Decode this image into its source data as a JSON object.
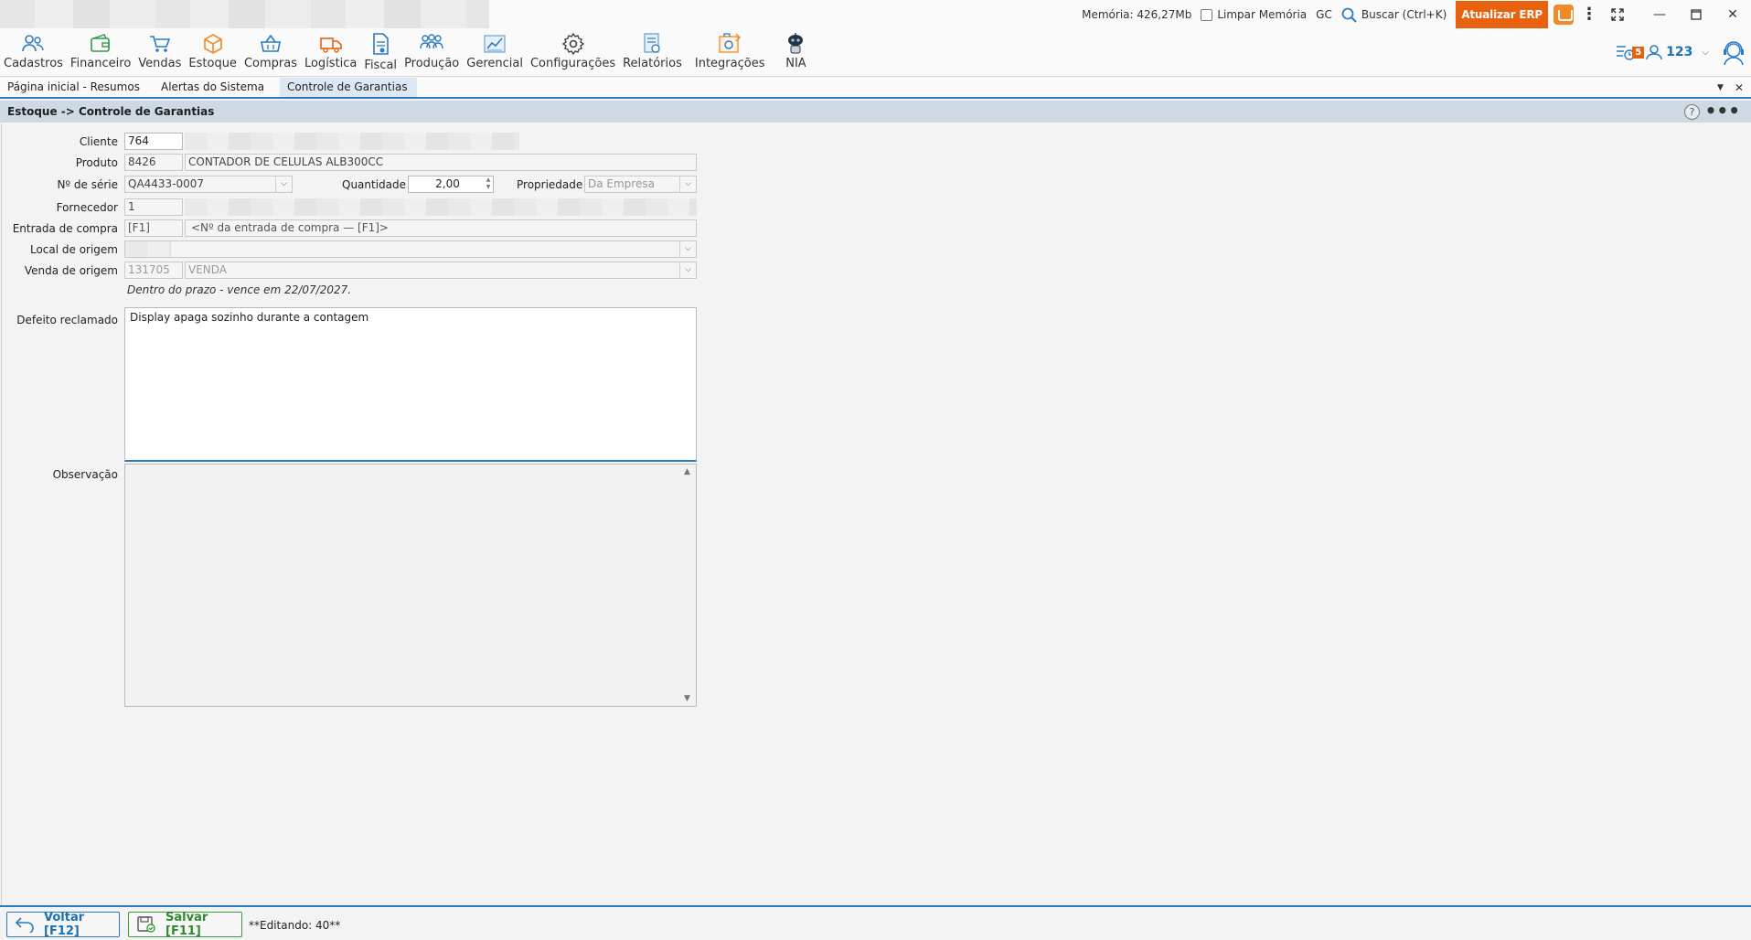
{
  "titlebar": {
    "memory": "Memória: 426,27Mb",
    "clear_memory": "Limpar Memória",
    "gc": "GC",
    "search": "Buscar (Ctrl+K)",
    "update_button": "Atualizar ERP"
  },
  "menu": {
    "items": [
      {
        "label": "Cadastros",
        "icon": "users-icon"
      },
      {
        "label": "Financeiro",
        "icon": "wallet-icon"
      },
      {
        "label": "Vendas",
        "icon": "cart-icon"
      },
      {
        "label": "Estoque",
        "icon": "box-icon"
      },
      {
        "label": "Compras",
        "icon": "basket-icon"
      },
      {
        "label": "Logística",
        "icon": "truck-icon"
      },
      {
        "label": "Fiscal",
        "icon": "document-icon"
      },
      {
        "label": "Produção",
        "icon": "team-icon"
      },
      {
        "label": "Gerencial",
        "icon": "chart-icon"
      },
      {
        "label": "Configurações",
        "icon": "gear-icon"
      },
      {
        "label": "Relatórios",
        "icon": "report-icon"
      },
      {
        "label": "Integrações",
        "icon": "puzzle-icon"
      },
      {
        "label": "NIA",
        "icon": "robot-icon"
      }
    ],
    "notifications": "5",
    "user_count": "123"
  },
  "tabs": [
    {
      "label": "Página inicial - Resumos"
    },
    {
      "label": "Alertas do Sistema"
    },
    {
      "label": "Controle de Garantias"
    }
  ],
  "page": {
    "title": "Estoque -> Controle de Garantias",
    "help": "?"
  },
  "form": {
    "cliente_label": "Cliente",
    "cliente_code": "764",
    "produto_label": "Produto",
    "produto_code": "8426",
    "produto_name": "CONTADOR DE CELULAS ALB300CC",
    "serie_label": "Nº de série",
    "serie_value": "QA4433-0007",
    "quantidade_label": "Quantidade",
    "quantidade_value": "2,00",
    "propriedade_label": "Propriedade",
    "propriedade_value": "Da Empresa",
    "fornecedor_label": "Fornecedor",
    "fornecedor_code": "1",
    "entrada_label": "Entrada de compra",
    "entrada_code": "[F1]",
    "entrada_placeholder": "<Nº da entrada de compra — [F1]>",
    "local_label": "Local de origem",
    "venda_label": "Venda de origem",
    "venda_code": "131705",
    "venda_type": "VENDA",
    "prazo_note": "Dentro do prazo - vence em 22/07/2027.",
    "defeito_label": "Defeito reclamado",
    "defeito_value": "Display apaga sozinho durante a contagem",
    "observacao_label": "Observação",
    "observacao_value": ""
  },
  "footer": {
    "back_label": "Voltar [F12]",
    "save_label": "Salvar [F11]",
    "status": "**Editando: 40**"
  },
  "colors": {
    "accent": "#2c7ac4",
    "update": "#e8610f",
    "save": "#2b8a2b"
  }
}
